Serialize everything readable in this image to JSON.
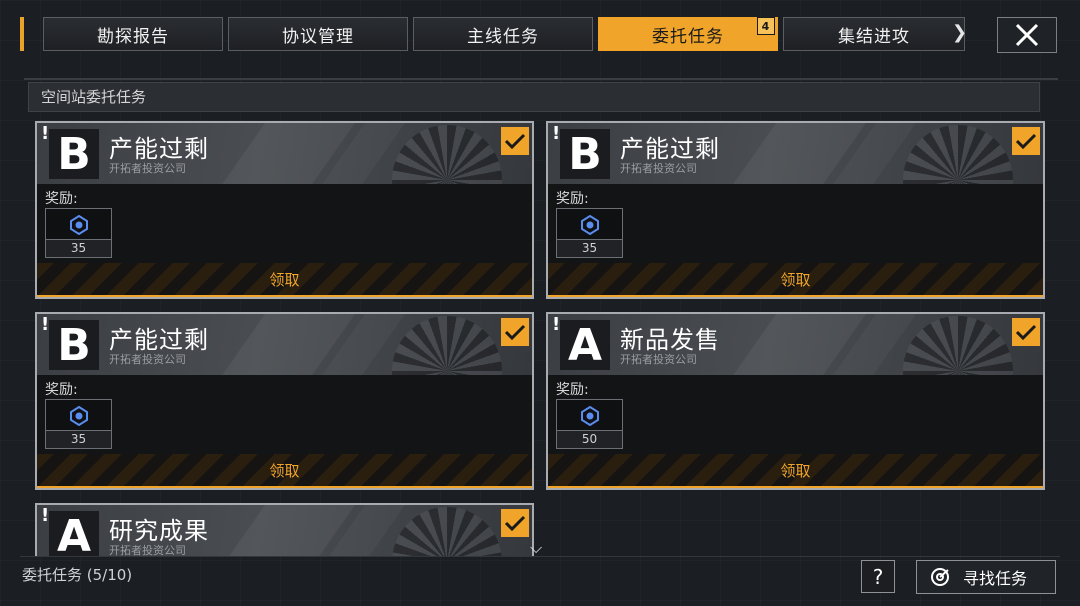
{
  "tabs": [
    {
      "label": "勘探报告",
      "active": false
    },
    {
      "label": "协议管理",
      "active": false
    },
    {
      "label": "主线任务",
      "active": false
    },
    {
      "label": "委托任务",
      "active": true,
      "badge": "4"
    },
    {
      "label": "集结进攻",
      "active": false
    }
  ],
  "tab_next_icon": "chevron-right-icon",
  "close_icon": "close-icon",
  "section": {
    "title": "空间站委托任务"
  },
  "cards": [
    {
      "rank": "B",
      "title": "产能过剩",
      "company": "开拓者投资公司",
      "reward_label": "奖励:",
      "reward_icon": "credit-gem-icon",
      "reward_count": "35",
      "claim_label": "领取",
      "checked": true
    },
    {
      "rank": "B",
      "title": "产能过剩",
      "company": "开拓者投资公司",
      "reward_label": "奖励:",
      "reward_icon": "credit-gem-icon",
      "reward_count": "35",
      "claim_label": "领取",
      "checked": true
    },
    {
      "rank": "B",
      "title": "产能过剩",
      "company": "开拓者投资公司",
      "reward_label": "奖励:",
      "reward_icon": "credit-gem-icon",
      "reward_count": "35",
      "claim_label": "领取",
      "checked": true
    },
    {
      "rank": "A",
      "title": "新品发售",
      "company": "开拓者投资公司",
      "reward_label": "奖励:",
      "reward_icon": "credit-gem-icon",
      "reward_count": "50",
      "claim_label": "领取",
      "checked": true
    },
    {
      "rank": "A",
      "title": "研究成果",
      "company": "开拓者投资公司",
      "checked": true
    }
  ],
  "footer": {
    "progress": "委托任务 (5/10)",
    "help_label": "?",
    "find_label": "寻找任务"
  },
  "colors": {
    "accent": "#f0a52a",
    "background": "#1b1e22",
    "card_border": "#a8abb0"
  }
}
